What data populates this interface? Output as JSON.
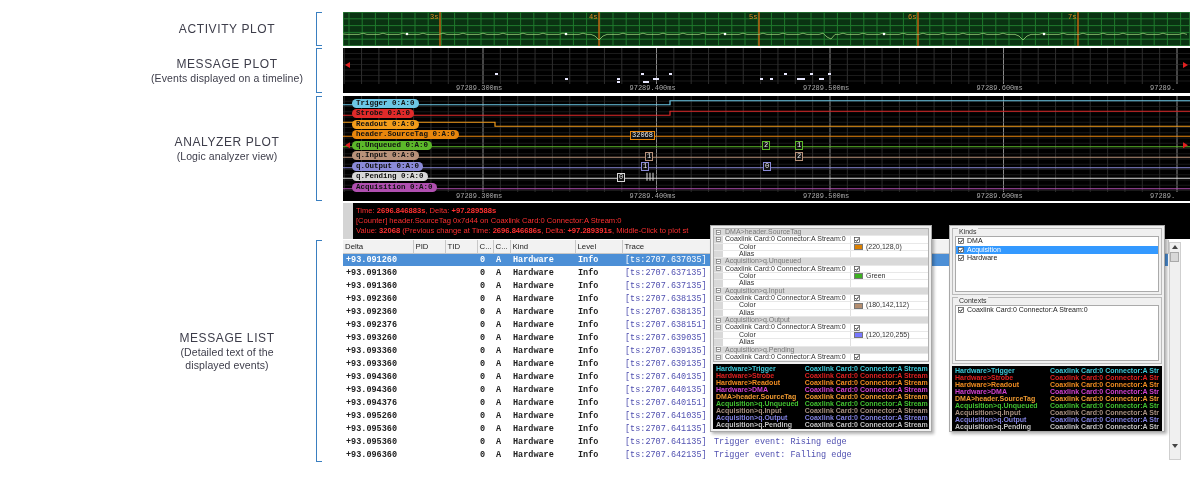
{
  "annotations": [
    {
      "title": "ACTIVITY PLOT"
    },
    {
      "title": "MESSAGE PLOT",
      "subtitle": "(Events displayed on a timeline)"
    },
    {
      "title": "ANALYZER PLOT",
      "subtitle": "(Logic analyzer view)"
    },
    {
      "title": "MESSAGE LIST",
      "subtitle": "(Detailed text of the displayed events)"
    }
  ],
  "activity_plot": {
    "second_labels": [
      "3s",
      "4s",
      "5s",
      "6s",
      "7s"
    ]
  },
  "message_plot": {
    "time_ticks": [
      "97289.300ms",
      "97289.400ms",
      "97289.500ms",
      "97289.600ms",
      "97289."
    ]
  },
  "analyzer_plot": {
    "signals": [
      {
        "label": "Trigger 0:A:0",
        "color": "#6cc7e6"
      },
      {
        "label": "Strobe 0:A:0",
        "color": "#e02a2a"
      },
      {
        "label": "Readout 0:A:0",
        "color": "#f39c1a"
      },
      {
        "label": "header.SourceTag 0:A:0",
        "color": "#e8860c",
        "markers": [
          "32068"
        ]
      },
      {
        "label": "q.Unqueued 0:A:0",
        "color": "#5cb82a",
        "markers": [
          "2",
          "1"
        ]
      },
      {
        "label": "q.Input 0:A:0",
        "color": "#b8927a",
        "markers": [
          "1",
          "2"
        ]
      },
      {
        "label": "q.Output 0:A:0",
        "color": "#8a8ad8",
        "markers": [
          "1",
          "0"
        ]
      },
      {
        "label": "q.Pending 0:A:0",
        "color": "#d8d8d8",
        "markers": [
          "0"
        ]
      },
      {
        "label": "Acquisition 0:A:0",
        "color": "#b04fb0"
      }
    ],
    "time_ticks": [
      "97289.300ms",
      "97289.400ms",
      "97289.500ms",
      "97289.600ms",
      "97289."
    ]
  },
  "info_bar": {
    "lines": [
      "Time: **2696.846883s**, Delta: **+97.289588s**",
      "[Counter] header.SourceTag 0x7d44 on Coaxlink Card:0 Connector:A Stream:0",
      "Value: **32068**  (Previous change at Time: **2696.846686s**, Delta: **+97.289391s**, Middle-Click to plot st"
    ]
  },
  "message_list": {
    "columns": [
      "Delta",
      "PID",
      "TID",
      "C...",
      "C...",
      "Kind",
      "Level",
      "Trace"
    ],
    "rows": [
      {
        "delta": "+93.091260",
        "c1": "0",
        "c2": "A",
        "kind": "Hardware",
        "level": "Info",
        "trace": "[ts:2707.637035]",
        "selected": true
      },
      {
        "delta": "+93.091360",
        "c1": "0",
        "c2": "A",
        "kind": "Hardware",
        "level": "Info",
        "trace": "[ts:2707.637135]",
        "selected": false
      },
      {
        "delta": "+93.091360",
        "c1": "0",
        "c2": "A",
        "kind": "Hardware",
        "level": "Info",
        "trace": "[ts:2707.637135]",
        "selected": false
      },
      {
        "delta": "+93.092360",
        "c1": "0",
        "c2": "A",
        "kind": "Hardware",
        "level": "Info",
        "trace": "[ts:2707.638135]",
        "selected": false
      },
      {
        "delta": "+93.092360",
        "c1": "0",
        "c2": "A",
        "kind": "Hardware",
        "level": "Info",
        "trace": "[ts:2707.638135]",
        "selected": false
      },
      {
        "delta": "+93.092376",
        "c1": "0",
        "c2": "A",
        "kind": "Hardware",
        "level": "Info",
        "trace": "[ts:2707.638151]",
        "selected": false
      },
      {
        "delta": "+93.093260",
        "c1": "0",
        "c2": "A",
        "kind": "Hardware",
        "level": "Info",
        "trace": "[ts:2707.639035]",
        "selected": false
      },
      {
        "delta": "+93.093360",
        "c1": "0",
        "c2": "A",
        "kind": "Hardware",
        "level": "Info",
        "trace": "[ts:2707.639135]",
        "selected": false
      },
      {
        "delta": "+93.093360",
        "c1": "0",
        "c2": "A",
        "kind": "Hardware",
        "level": "Info",
        "trace": "[ts:2707.639135]",
        "selected": false
      },
      {
        "delta": "+93.094360",
        "c1": "0",
        "c2": "A",
        "kind": "Hardware",
        "level": "Info",
        "trace": "[ts:2707.640135]",
        "selected": false
      },
      {
        "delta": "+93.094360",
        "c1": "0",
        "c2": "A",
        "kind": "Hardware",
        "level": "Info",
        "trace": "[ts:2707.640135]",
        "selected": false
      },
      {
        "delta": "+93.094376",
        "c1": "0",
        "c2": "A",
        "kind": "Hardware",
        "level": "Info",
        "trace": "[ts:2707.640151]",
        "selected": false
      },
      {
        "delta": "+93.095260",
        "c1": "0",
        "c2": "A",
        "kind": "Hardware",
        "level": "Info",
        "trace": "[ts:2707.641035]",
        "selected": false
      },
      {
        "delta": "+93.095360",
        "c1": "0",
        "c2": "A",
        "kind": "Hardware",
        "level": "Info",
        "trace": "[ts:2707.641135]",
        "selected": false
      },
      {
        "delta": "+93.095360",
        "c1": "0",
        "c2": "A",
        "kind": "Hardware",
        "level": "Info",
        "trace": "[ts:2707.641135]",
        "message": "Trigger event: Rising edge",
        "selected": false
      },
      {
        "delta": "+93.096360",
        "c1": "0",
        "c2": "A",
        "kind": "Hardware",
        "level": "Info",
        "trace": "[ts:2707.642135]",
        "message": "Trigger event: Falling edge",
        "selected": false
      }
    ]
  },
  "properties_panel": {
    "sections": [
      {
        "title": "DMA>header.SourceTag",
        "expanded": true,
        "stream": "Coaxlink Card:0 Connector:A Stream:0",
        "stream_expanded": true,
        "checked": true,
        "color_label": "Color",
        "color": "#dc8000",
        "color_value": "(220,128,0)",
        "alias_label": "Alias"
      },
      {
        "title": "Acquisition>q.Unqueued",
        "expanded": true,
        "stream": "Coaxlink Card:0 Connector:A Stream:0",
        "stream_expanded": true,
        "checked": true,
        "color_label": "Color",
        "color": "#3cb020",
        "color_value": "Green",
        "alias_label": "Alias"
      },
      {
        "title": "Acquisition>q.Input",
        "expanded": true,
        "stream": "Coaxlink Card:0 Connector:A Stream:0",
        "stream_expanded": true,
        "checked": true,
        "color_label": "Color",
        "color": "#b48e70",
        "color_value": "(180,142,112)",
        "alias_label": "Alias"
      },
      {
        "title": "Acquisition>q.Output",
        "expanded": true,
        "stream": "Coaxlink Card:0 Connector:A Stream:0",
        "stream_expanded": true,
        "checked": true,
        "color_label": "Color",
        "color": "#7878ff",
        "color_value": "(120,120,255)",
        "alias_label": "Alias"
      },
      {
        "title": "Acquisition>q.Pending",
        "expanded": true,
        "stream": "Coaxlink Card:0 Connector:A Stream:0",
        "stream_expanded": true,
        "checked": true
      }
    ],
    "legend": [
      {
        "name": "Hardware>Trigger",
        "source": "Coaxlink Card:0 Connector:A Stream",
        "color": "#3cc8d8"
      },
      {
        "name": "Hardware>Strobe",
        "source": "Coaxlink Card:0 Connector:A Stream",
        "color": "#e02020"
      },
      {
        "name": "Hardware>Readout",
        "source": "Coaxlink Card:0 Connector:A Stream",
        "color": "#f08c20"
      },
      {
        "name": "Hardware>DMA",
        "source": "Coaxlink Card:0 Connector:A Stream",
        "color": "#d040d0"
      },
      {
        "name": "DMA>header.SourceTag",
        "source": "Coaxlink Card:0 Connector:A Stream",
        "color": "#f09a30"
      },
      {
        "name": "Acquisition>q.Unqueued",
        "source": "Coaxlink Card:0 Connector:A Stream",
        "color": "#40c030"
      },
      {
        "name": "Acquisition>q.Input",
        "source": "Coaxlink Card:0 Connector:A Stream",
        "color": "#a89080"
      },
      {
        "name": "Acquisition>q.Output",
        "source": "Coaxlink Card:0 Connector:A Stream",
        "color": "#8080e0"
      },
      {
        "name": "Acquisition>q.Pending",
        "source": "Coaxlink Card:0 Connector:A Stream",
        "color": "#c0c0c0"
      }
    ]
  },
  "filter_panel": {
    "kinds_title": "Kinds",
    "kinds": [
      {
        "label": "DMA",
        "checked": true,
        "selected": false
      },
      {
        "label": "Acquisition",
        "checked": true,
        "selected": true
      },
      {
        "label": "Hardware",
        "checked": true,
        "selected": false
      }
    ],
    "contexts_title": "Contexts",
    "contexts": [
      {
        "label": "Coaxlink Card:0 Connector:A Stream:0",
        "checked": true,
        "selected": false
      }
    ],
    "legend": [
      {
        "name": "Hardware>Trigger",
        "source": "Coaxlink Card:0 Connector:A Str",
        "color": "#3cc8d8"
      },
      {
        "name": "Hardware>Strobe",
        "source": "Coaxlink Card:0 Connector:A Str",
        "color": "#e02020"
      },
      {
        "name": "Hardware>Readout",
        "source": "Coaxlink Card:0 Connector:A Str",
        "color": "#f08c20"
      },
      {
        "name": "Hardware>DMA",
        "source": "Coaxlink Card:0 Connector:A Str",
        "color": "#d040d0"
      },
      {
        "name": "DMA>header.SourceTag",
        "source": "Coaxlink Card:0 Connector:A Str",
        "color": "#f09a30"
      },
      {
        "name": "Acquisition>q.Unqueued",
        "source": "Coaxlink Card:0 Connector:A Str",
        "color": "#40c030"
      },
      {
        "name": "Acquisition>q.Input",
        "source": "Coaxlink Card:0 Connector:A Str",
        "color": "#a89080"
      },
      {
        "name": "Acquisition>q.Output",
        "source": "Coaxlink Card:0 Connector:A Str",
        "color": "#8080e0"
      },
      {
        "name": "Acquisition>q.Pending",
        "source": "Coaxlink Card:0 Connector:A Str",
        "color": "#c0c0c0"
      }
    ]
  }
}
